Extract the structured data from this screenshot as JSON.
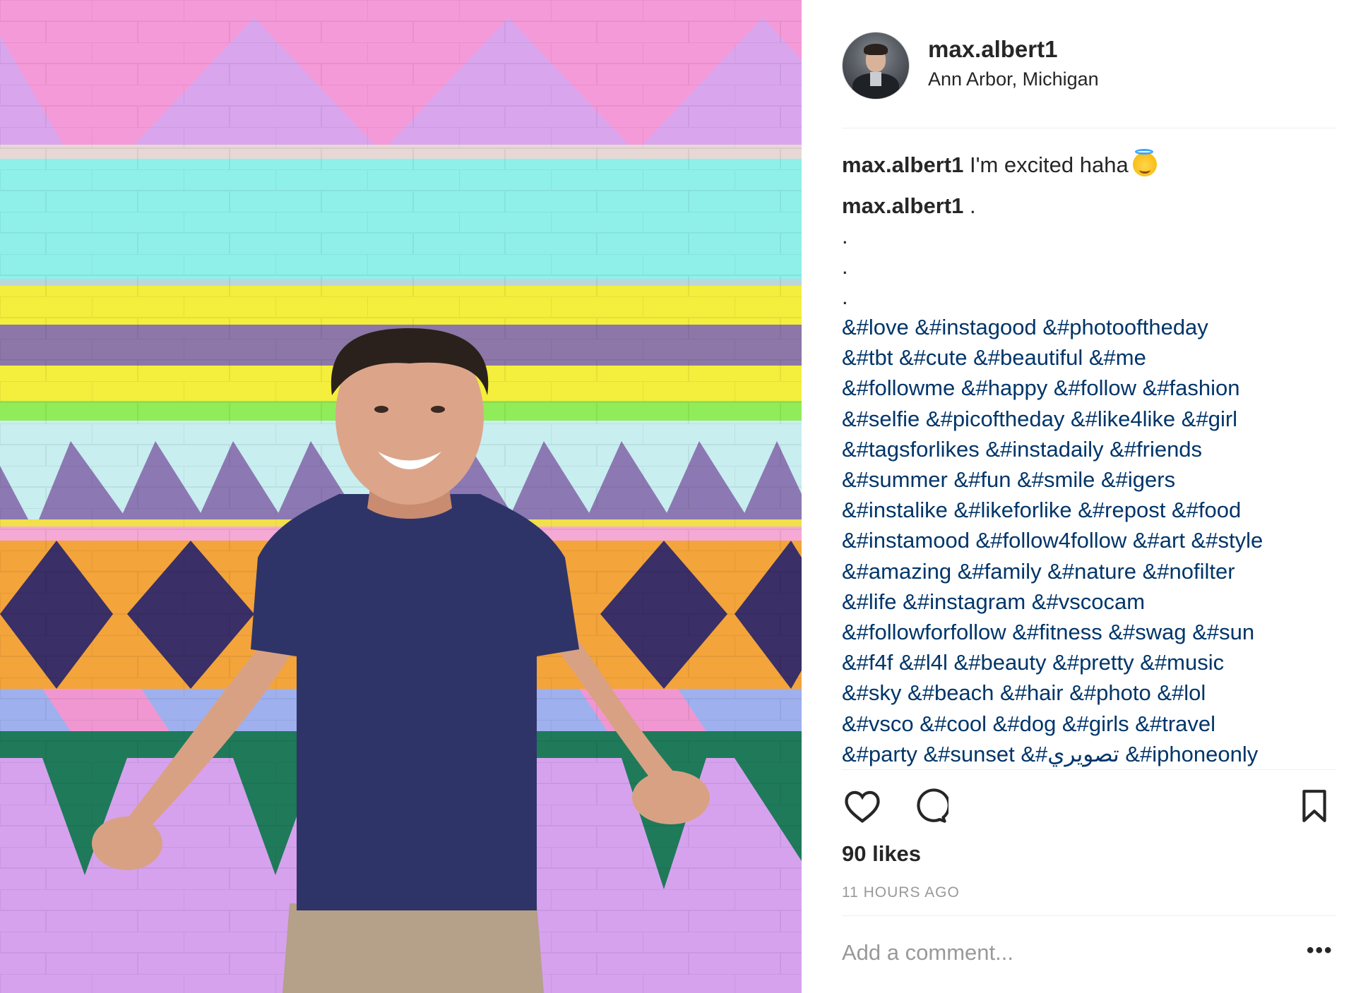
{
  "post": {
    "username": "max.albert1",
    "location": "Ann Arbor, Michigan",
    "caption_text": "I'm excited haha",
    "caption_emoji": "smiling-face-with-halo-emoji",
    "comment_username": "max.albert1",
    "comment_first": ".",
    "dots": [
      ".",
      ".",
      "."
    ],
    "hashtag_lines": [
      "&#love &#instagood &#photooftheday",
      "&#tbt &#cute &#beautiful &#me",
      "&#followme &#happy &#follow &#fashion",
      "&#selfie &#picoftheday &#like4like &#girl",
      "&#tagsforlikes &#instadaily &#friends",
      "&#summer &#fun &#smile &#igers",
      "&#instalike &#likeforlike &#repost &#food",
      "&#instamood &#follow4follow &#art &#style",
      "&#amazing &#family &#nature &#nofilter",
      "&#life &#instagram &#vscocam",
      "&#followforfollow &#fitness &#swag &#sun",
      "&#f4f &#l4l &#beauty &#pretty &#music",
      "&#sky &#beach &#hair &#photo &#lol",
      "&#vsco &#cool &#dog &#girls &#travel",
      "&#party &#sunset &#تصويري &#iphoneonly"
    ],
    "likes": "90 likes",
    "time_ago": "11 HOURS AGO",
    "comment_placeholder": "Add a comment...",
    "more_options": "•••"
  },
  "icons": {
    "like": "heart-icon",
    "comment": "comment-icon",
    "save": "bookmark-icon",
    "more": "more-options-icon"
  },
  "colors": {
    "hashtag": "#003569",
    "text": "#262626",
    "muted": "#999999",
    "divider": "#efefef"
  }
}
